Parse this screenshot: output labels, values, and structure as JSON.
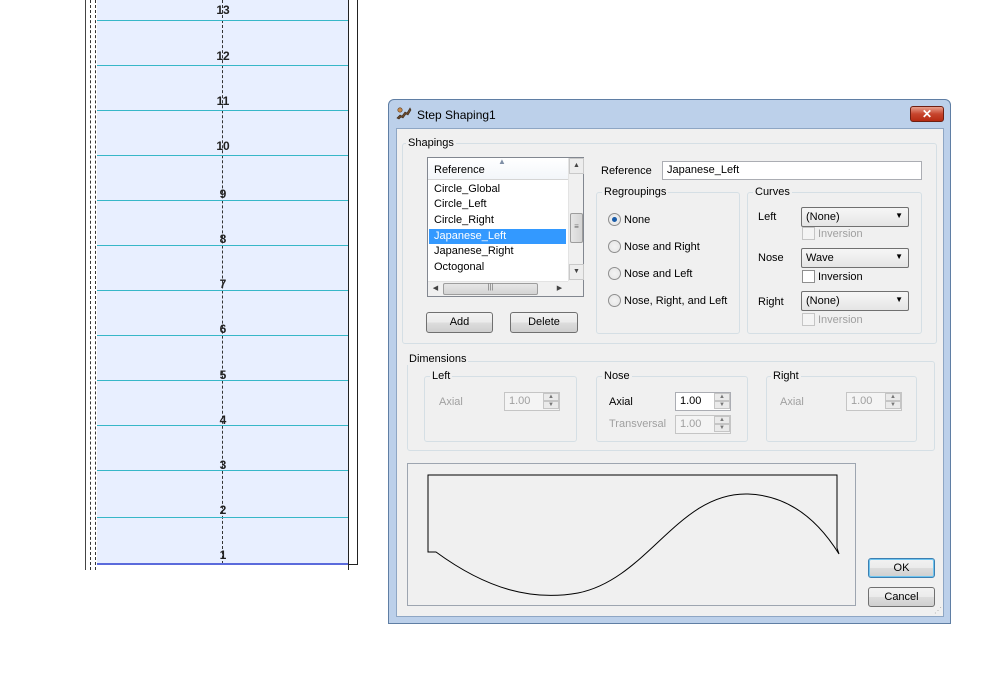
{
  "staircase": {
    "step_numbers": [
      "13",
      "12",
      "11",
      "10",
      "9",
      "8",
      "7",
      "6",
      "5",
      "4",
      "3",
      "2",
      "1"
    ]
  },
  "dialog": {
    "title": "Step Shaping1",
    "close_glyph": "✕",
    "shapings": {
      "legend": "Shapings",
      "list_header": "Reference",
      "list_items": [
        "Circle_Global",
        "Circle_Left",
        "Circle_Right",
        "Japanese_Left",
        "Japanese_Right",
        "Octogonal"
      ],
      "selected_item": "Japanese_Left",
      "add_label": "Add",
      "delete_label": "Delete",
      "reference_label": "Reference",
      "reference_value": "Japanese_Left",
      "regroupings": {
        "legend": "Regroupings",
        "options": [
          "None",
          "Nose and Right",
          "Nose and Left",
          "Nose, Right, and Left"
        ],
        "selected": "None"
      },
      "curves": {
        "legend": "Curves",
        "left_label": "Left",
        "left_value": "(None)",
        "nose_label": "Nose",
        "nose_value": "Wave",
        "right_label": "Right",
        "right_value": "(None)",
        "inversion_label": "Inversion"
      }
    },
    "dimensions": {
      "legend": "Dimensions",
      "left": {
        "legend": "Left",
        "axial_label": "Axial",
        "axial_value": "1.00"
      },
      "nose": {
        "legend": "Nose",
        "axial_label": "Axial",
        "axial_value": "1.00",
        "transversal_label": "Transversal",
        "transversal_value": "1.00"
      },
      "right": {
        "legend": "Right",
        "axial_label": "Axial",
        "axial_value": "1.00"
      }
    },
    "ok_label": "OK",
    "cancel_label": "Cancel"
  },
  "colors": {
    "tread_fill": "#e8efff",
    "tread_line": "#37b7c8",
    "selection": "#3399ff",
    "title_bar": "#bcd0ea",
    "close_button": "#c7452d"
  },
  "icons": [
    "step-tool-icon",
    "close-icon",
    "sort-up-icon",
    "scroll-up-icon",
    "scroll-down-icon",
    "scroll-left-icon",
    "scroll-right-icon",
    "dropdown-arrow-icon",
    "spin-up-icon",
    "spin-down-icon",
    "resize-grip-icon"
  ]
}
